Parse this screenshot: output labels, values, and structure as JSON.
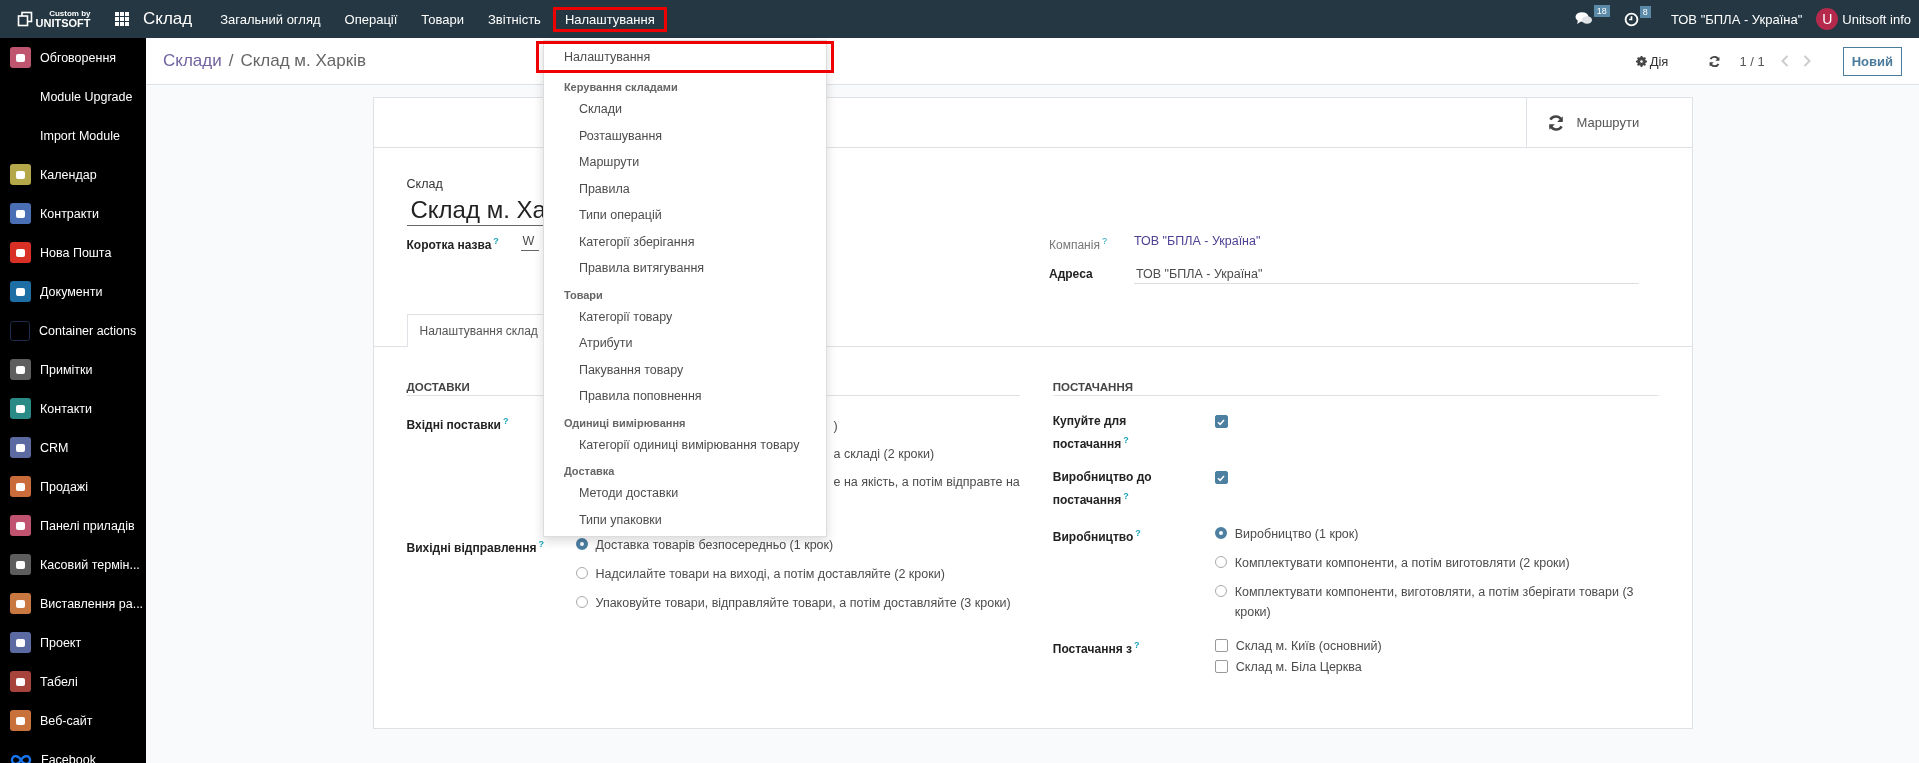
{
  "top_bar": {
    "brand_small": "Custom by",
    "brand": "UNITSOFT",
    "app_name": "Склад",
    "menu": [
      {
        "label": "Загальний огляд",
        "selected": false
      },
      {
        "label": "Операції",
        "selected": false
      },
      {
        "label": "Товари",
        "selected": false
      },
      {
        "label": "Звітність",
        "selected": false
      },
      {
        "label": "Налаштування",
        "selected": true
      }
    ],
    "messages_count": "18",
    "activities_count": "8",
    "company": "ТОВ \"БПЛА - Україна\"",
    "avatar_letter": "U",
    "user": "Unitsoft info"
  },
  "settings_menu": {
    "items": [
      {
        "kind": "item",
        "label": "Налаштування",
        "highlighted": true
      },
      {
        "kind": "header",
        "label": "Керування складами"
      },
      {
        "kind": "item",
        "label": "Склади",
        "highlighted": false
      },
      {
        "kind": "item",
        "label": "Розташування",
        "highlighted": false
      },
      {
        "kind": "item",
        "label": "Маршрути",
        "highlighted": false
      },
      {
        "kind": "item",
        "label": "Правила",
        "highlighted": false
      },
      {
        "kind": "item",
        "label": "Типи операцій",
        "highlighted": false
      },
      {
        "kind": "item",
        "label": "Категорії зберігання",
        "highlighted": false
      },
      {
        "kind": "item",
        "label": "Правила витягування",
        "highlighted": false
      },
      {
        "kind": "header",
        "label": "Товари"
      },
      {
        "kind": "item",
        "label": "Категорії товару",
        "highlighted": false
      },
      {
        "kind": "item",
        "label": "Атрибути",
        "highlighted": false
      },
      {
        "kind": "item",
        "label": "Пакування товару",
        "highlighted": false
      },
      {
        "kind": "item",
        "label": "Правила поповнення",
        "highlighted": false
      },
      {
        "kind": "header",
        "label": "Одиниці вимірювання"
      },
      {
        "kind": "item",
        "label": "Категорії одиниці вимірювання товару",
        "highlighted": false
      },
      {
        "kind": "header",
        "label": "Доставка"
      },
      {
        "kind": "item",
        "label": "Методи доставки",
        "highlighted": false
      },
      {
        "kind": "item",
        "label": "Типи упаковки",
        "highlighted": false
      }
    ]
  },
  "sidebar": {
    "items": [
      {
        "label": "Обговорення",
        "kind": "tile",
        "color": "#c0556f"
      },
      {
        "label": "Module Upgrade",
        "kind": "none"
      },
      {
        "label": "Import Module",
        "kind": "none"
      },
      {
        "label": "Календар",
        "kind": "tile",
        "color": "#b5a84a"
      },
      {
        "label": "Контракти",
        "kind": "tile",
        "color": "#4b6fb5"
      },
      {
        "label": "Нова Пошта",
        "kind": "tile",
        "color": "#d93025"
      },
      {
        "label": "Документи",
        "kind": "tile",
        "color": "#1c6ea4"
      },
      {
        "label": "Container actions",
        "kind": "outline",
        "color": "#1d2a4a"
      },
      {
        "label": "Примітки",
        "kind": "tile",
        "color": "#5e5e5e"
      },
      {
        "label": "Контакти",
        "kind": "tile",
        "color": "#2a8a86"
      },
      {
        "label": "CRM",
        "kind": "tile",
        "color": "#5b6aa0"
      },
      {
        "label": "Продажі",
        "kind": "tile",
        "color": "#c96b3b"
      },
      {
        "label": "Панелі приладів",
        "kind": "tile",
        "color": "#c05470"
      },
      {
        "label": "Касовий термін...",
        "kind": "tile",
        "color": "#5d5d5d"
      },
      {
        "label": "Виставлення ра...",
        "kind": "tile",
        "color": "#c87840"
      },
      {
        "label": "Проект",
        "kind": "tile",
        "color": "#5b6aa0"
      },
      {
        "label": "Табелі",
        "kind": "tile",
        "color": "#a6443c"
      },
      {
        "label": "Веб-сайт",
        "kind": "tile",
        "color": "#c8713b"
      },
      {
        "label": "Facebook",
        "kind": "infinity",
        "color": "#1877f2"
      }
    ]
  },
  "control_panel": {
    "breadcrumb_parent": "Склади",
    "separator": "/",
    "breadcrumb_current": "Склад м. Харків",
    "action": "Дія",
    "pager": "1 / 1",
    "new_button": "Новий"
  },
  "form": {
    "smart_button": "Маршрути",
    "name_label": "Склад",
    "name": "Склад м. Ха",
    "short_name_label": "Коротка назва",
    "short_name_help": "?",
    "short_name": "W",
    "company_label": "Компанія",
    "company_help": "?",
    "company": "ТОВ \"БПЛА - Україна\"",
    "address_label": "Адреса",
    "address": "ТОВ \"БПЛА - Україна\"",
    "tab": "Налаштування склад",
    "deliveries": {
      "title": "ДОСТАВКИ",
      "rows": [
        {
          "kind": "covered",
          "label": "Вхідні поставки",
          "help": "?",
          "fragments": [
            ")",
            "а складі (2 кроки)",
            "е на якість, а потім відправте на"
          ]
        },
        {
          "kind": "radio",
          "label": "Вихідні відправлення",
          "help": "?",
          "options": [
            {
              "label": "Доставка товарів безпосередньо (1 крок)",
              "selected": true
            },
            {
              "label": "Надсилайте товари на виході, а потім доставляйте (2 кроки)",
              "selected": false
            },
            {
              "label": "Упаковуйте товари, відправляйте товари, а потім доставляйте (3 кроки)",
              "selected": false
            }
          ]
        }
      ]
    },
    "supply": {
      "title": "ПОСТАЧАННЯ",
      "rows": [
        {
          "kind": "checkbox",
          "label": "Купуйте для постачання",
          "help": "?",
          "checked": true
        },
        {
          "kind": "checkbox",
          "label": "Виробництво до постачання",
          "help": "?",
          "checked": true
        },
        {
          "kind": "radio",
          "label": "Виробництво",
          "help": "?",
          "options": [
            {
              "label": "Виробництво (1 крок)",
              "selected": true
            },
            {
              "label": "Комплектувати компоненти, а потім виготовляти (2 кроки)",
              "selected": false
            },
            {
              "label": "Комплектувати компоненти, виготовляти, а потім зберігати товари (3 кроки)",
              "selected": false
            }
          ]
        },
        {
          "kind": "checklist",
          "label": "Постачання з",
          "help": "?",
          "options": [
            {
              "label": "Склад м. Київ (основний)",
              "checked": false
            },
            {
              "label": "Склад м. Біла Церква",
              "checked": false
            }
          ]
        }
      ]
    }
  }
}
